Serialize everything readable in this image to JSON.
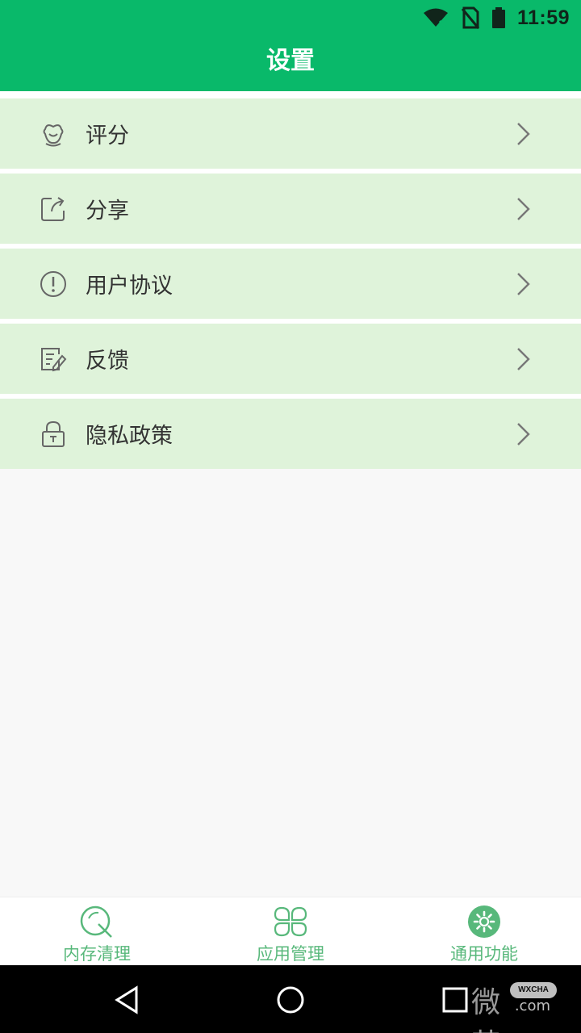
{
  "status_bar": {
    "time": "11:59",
    "icons": [
      "wifi-icon",
      "no-sim-icon",
      "battery-icon"
    ]
  },
  "header": {
    "title": "设置"
  },
  "settings": {
    "items": [
      {
        "label": "评分",
        "icon": "rate-flower-icon"
      },
      {
        "label": "分享",
        "icon": "share-icon"
      },
      {
        "label": "用户协议",
        "icon": "info-icon"
      },
      {
        "label": "反馈",
        "icon": "feedback-edit-icon"
      },
      {
        "label": "隐私政策",
        "icon": "lock-icon"
      }
    ]
  },
  "bottom_nav": {
    "tabs": [
      {
        "label": "内存清理",
        "icon": "memory-clean-icon",
        "active": false
      },
      {
        "label": "应用管理",
        "icon": "app-grid-icon",
        "active": false
      },
      {
        "label": "通用功能",
        "icon": "gear-icon",
        "active": true
      }
    ]
  },
  "watermark": {
    "chinese": "微茶",
    "badge": "WXCHA",
    "suffix": ".com"
  },
  "colors": {
    "primary": "#09b96a",
    "row_background": "#dff3da",
    "nav_text": "#58b87b",
    "system_bar": "#000000"
  }
}
